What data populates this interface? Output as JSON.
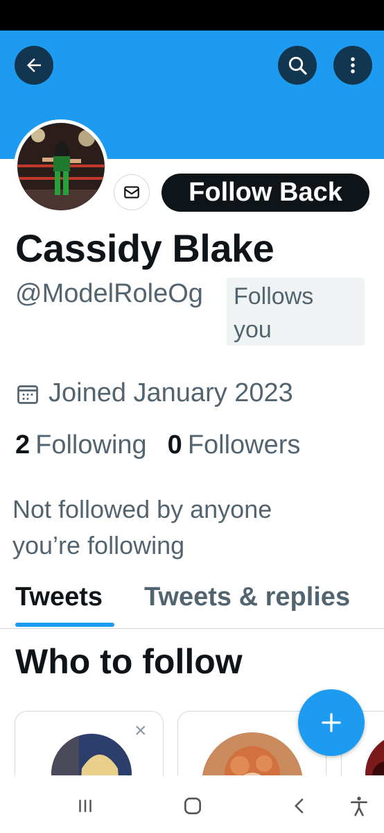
{
  "colors": {
    "banner": "#1d9bf0",
    "accent": "#1d9bf0",
    "text": "#0f1419",
    "secondary": "#536471"
  },
  "header": {
    "back_icon": "arrow-left-icon",
    "search_icon": "search-icon",
    "more_icon": "more-vertical-icon"
  },
  "profile": {
    "name": "Cassidy Blake",
    "handle": "@ModelRoleOg",
    "follows_you": "Follows you",
    "joined": "Joined January 2023",
    "following_count": "2",
    "following_label": "Following",
    "followers_count": "0",
    "followers_label": "Followers",
    "not_followed": "Not followed by anyone you’re following"
  },
  "actions": {
    "message_icon": "mail-icon",
    "follow_back_label": "Follow Back"
  },
  "tabs": [
    {
      "label": "Tweets",
      "active": true
    },
    {
      "label": "Tweets & replies",
      "active": false
    }
  ],
  "who_to_follow": {
    "title": "Who to follow",
    "dismiss_label": "×"
  },
  "fab": {
    "label": "+"
  },
  "nav_bar": {
    "items": [
      "recent-apps-icon",
      "home-icon",
      "back-icon",
      "accessibility-icon"
    ]
  }
}
